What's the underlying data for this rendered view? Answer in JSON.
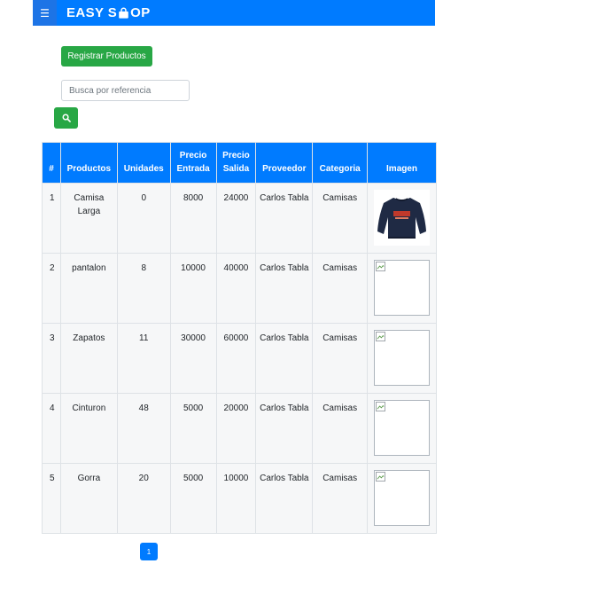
{
  "navbar": {
    "toggle_icon": "hamburger-icon",
    "brand_before": "EASY S",
    "brand_icon": "shopping-bag-icon",
    "brand_after": "OP"
  },
  "actions": {
    "register_label": "Registrar Productos",
    "search_icon": "search-icon"
  },
  "search": {
    "placeholder": "Busca por referencia",
    "value": ""
  },
  "colors": {
    "primary": "#007bff",
    "success": "#28a745"
  },
  "table": {
    "headers": [
      "#",
      "Productos",
      "Unidades",
      "Precio Entrada",
      "Precio Salida",
      "Proveedor",
      "Categoria",
      "Imagen"
    ],
    "rows": [
      {
        "id": "1",
        "producto": "Camisa Larga",
        "unidades": "0",
        "precio_entrada": "8000",
        "precio_salida": "24000",
        "proveedor": "Carlos Tabla",
        "categoria": "Camisas",
        "imagen": "product-photo-long-sleeve-shirt"
      },
      {
        "id": "2",
        "producto": "pantalon",
        "unidades": "8",
        "precio_entrada": "10000",
        "precio_salida": "40000",
        "proveedor": "Carlos Tabla",
        "categoria": "Camisas",
        "imagen": "broken-image-icon"
      },
      {
        "id": "3",
        "producto": "Zapatos",
        "unidades": "11",
        "precio_entrada": "30000",
        "precio_salida": "60000",
        "proveedor": "Carlos Tabla",
        "categoria": "Camisas",
        "imagen": "broken-image-icon"
      },
      {
        "id": "4",
        "producto": "Cinturon",
        "unidades": "48",
        "precio_entrada": "5000",
        "precio_salida": "20000",
        "proveedor": "Carlos Tabla",
        "categoria": "Camisas",
        "imagen": "broken-image-icon"
      },
      {
        "id": "5",
        "producto": "Gorra",
        "unidades": "20",
        "precio_entrada": "5000",
        "precio_salida": "10000",
        "proveedor": "Carlos Tabla",
        "categoria": "Camisas",
        "imagen": "broken-image-icon"
      }
    ]
  },
  "pagination": {
    "current_page": "1"
  }
}
